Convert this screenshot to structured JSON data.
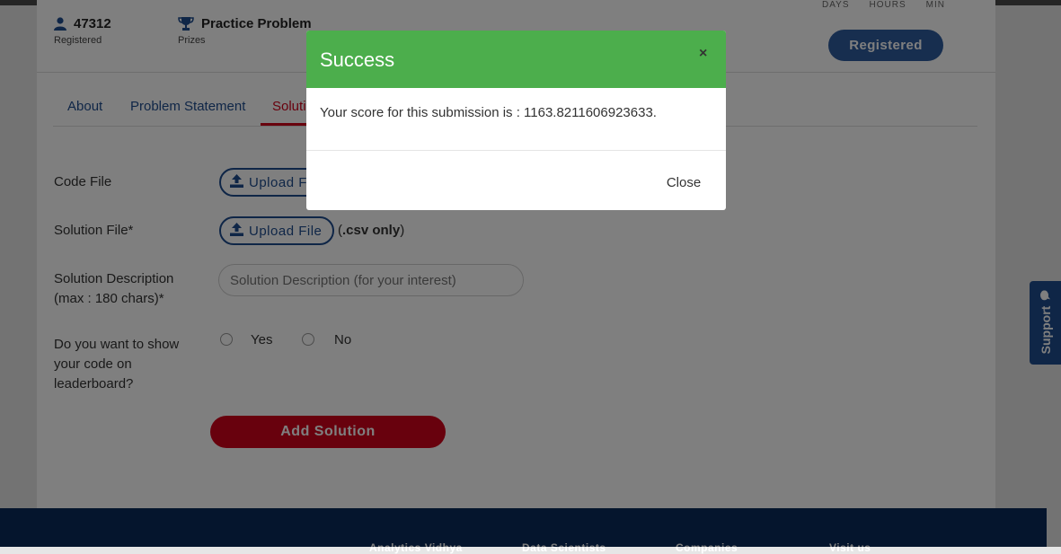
{
  "header": {
    "registered_count": "47312",
    "registered_label": "Registered",
    "prizes_value": "Practice Problem",
    "prizes_label": "Prizes",
    "timer_labels": [
      "DAYS",
      "HOURS",
      "MIN"
    ],
    "register_button": "Registered"
  },
  "tabs": [
    {
      "label": "About"
    },
    {
      "label": "Problem Statement"
    },
    {
      "label": "Soluti"
    }
  ],
  "form": {
    "code_file_label": "Code File",
    "code_upload_button": "Upload F",
    "solution_file_label": "Solution File*",
    "solution_upload_button": "Upload File",
    "csv_note_prefix": "(",
    "csv_note_bold": ".csv only",
    "csv_note_suffix": ")",
    "description_label_line1": "Solution Description",
    "description_label_line2": "(max : 180 chars)*",
    "description_placeholder": "Solution Description (for your interest)",
    "show_code_line1": "Do you want to show",
    "show_code_line2": "your code on",
    "show_code_line3": "leaderboard?",
    "option_yes": "Yes",
    "option_no": "No",
    "submit_button": "Add Solution"
  },
  "footer": {
    "columns": [
      "Analytics Vidhya",
      "Data Scientists",
      "Companies",
      "Visit us"
    ]
  },
  "support": {
    "label": "Support"
  },
  "modal": {
    "title": "Success",
    "close_x": "×",
    "message": "Your score for this submission is : 1163.8211606923633.",
    "close_button": "Close"
  },
  "colors": {
    "modal_header": "#4cae4c",
    "primary_blue": "#1f4c8f",
    "accent_red": "#d0021b",
    "footer_bg": "#0b2a5a"
  },
  "icons": [
    "user-icon",
    "trophy-icon",
    "upload-icon",
    "chat-bubble-icon"
  ]
}
